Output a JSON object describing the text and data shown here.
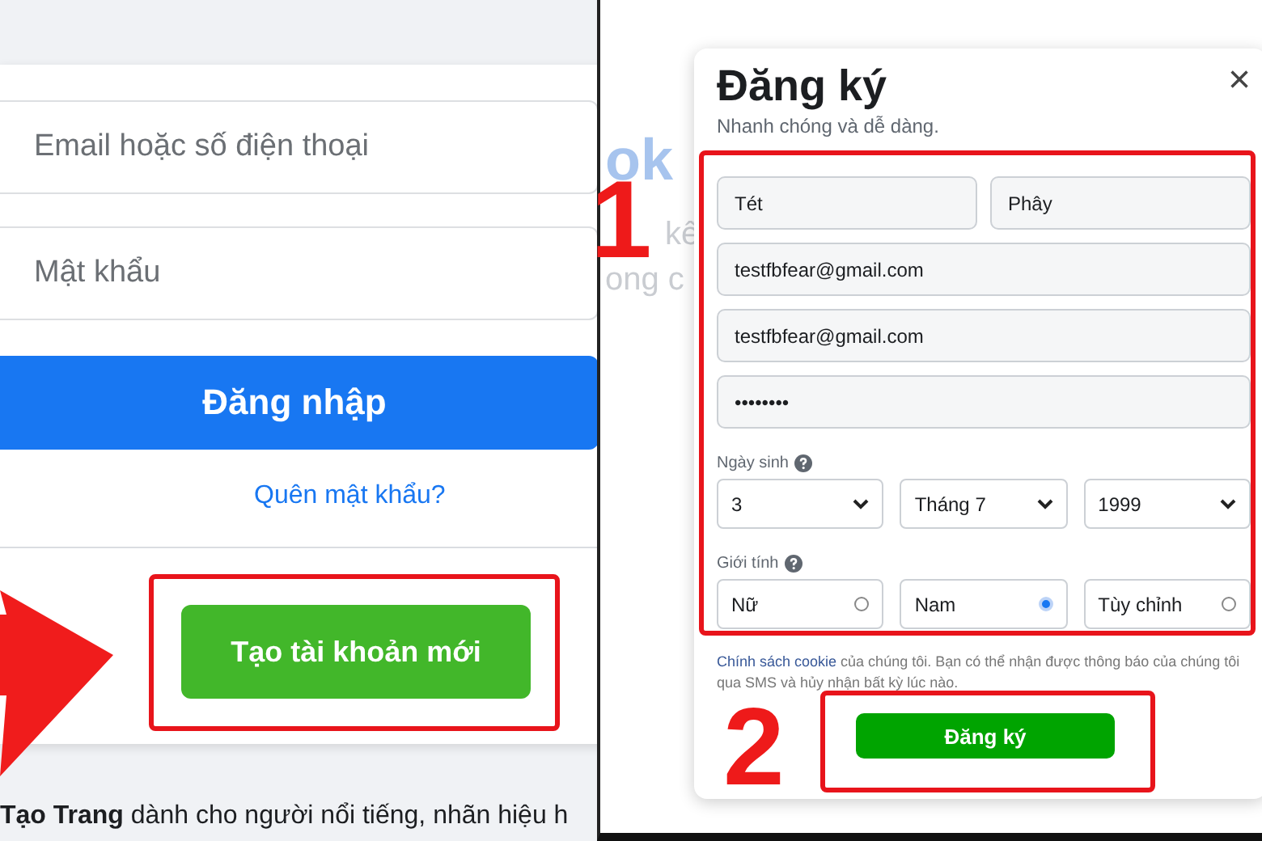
{
  "login_panel": {
    "email_field": {
      "placeholder": "Email hoặc số điện thoại"
    },
    "password_field": {
      "placeholder": "Mật khẩu"
    },
    "login_button": "Đăng nhập",
    "forgot_link": "Quên mật khẩu?",
    "create_account_button": "Tạo tài khoản mới",
    "create_page_text": "**Tạo Trang** dành cho người nổi tiếng, nhãn hiệu h"
  },
  "background_fragments": [
    "ok",
    "kế",
    "ong c"
  ],
  "signup_dialog": {
    "title": "Đăng ký",
    "subtitle": "Nhanh chóng và dễ dàng.",
    "close": "×",
    "first_name": "Tét",
    "last_name": "Phây",
    "email": "testfbfear@gmail.com",
    "email_confirm": "testfbfear@gmail.com",
    "password": "••••••••",
    "birthday_label": "Ngày sinh",
    "birthday": [
      "3",
      "Tháng 7",
      "1999"
    ],
    "gender_label": "Giới tính",
    "genders": [
      {
        "label": "Nữ",
        "selected": false
      },
      {
        "label": "Nam",
        "selected": true
      },
      {
        "label": "Tùy chỉnh",
        "selected": false
      }
    ],
    "terms": {
      "link": "Chính sách cookie",
      "text": " của chúng tôi. Bạn có thể nhận được thông báo của chúng tôi qua SMS và hủy nhận bất kỳ lúc nào."
    },
    "submit_button": "Đăng ký"
  },
  "annotations": [
    {
      "kind": "step-number",
      "text": "1"
    },
    {
      "kind": "step-number",
      "text": "2"
    }
  ]
}
